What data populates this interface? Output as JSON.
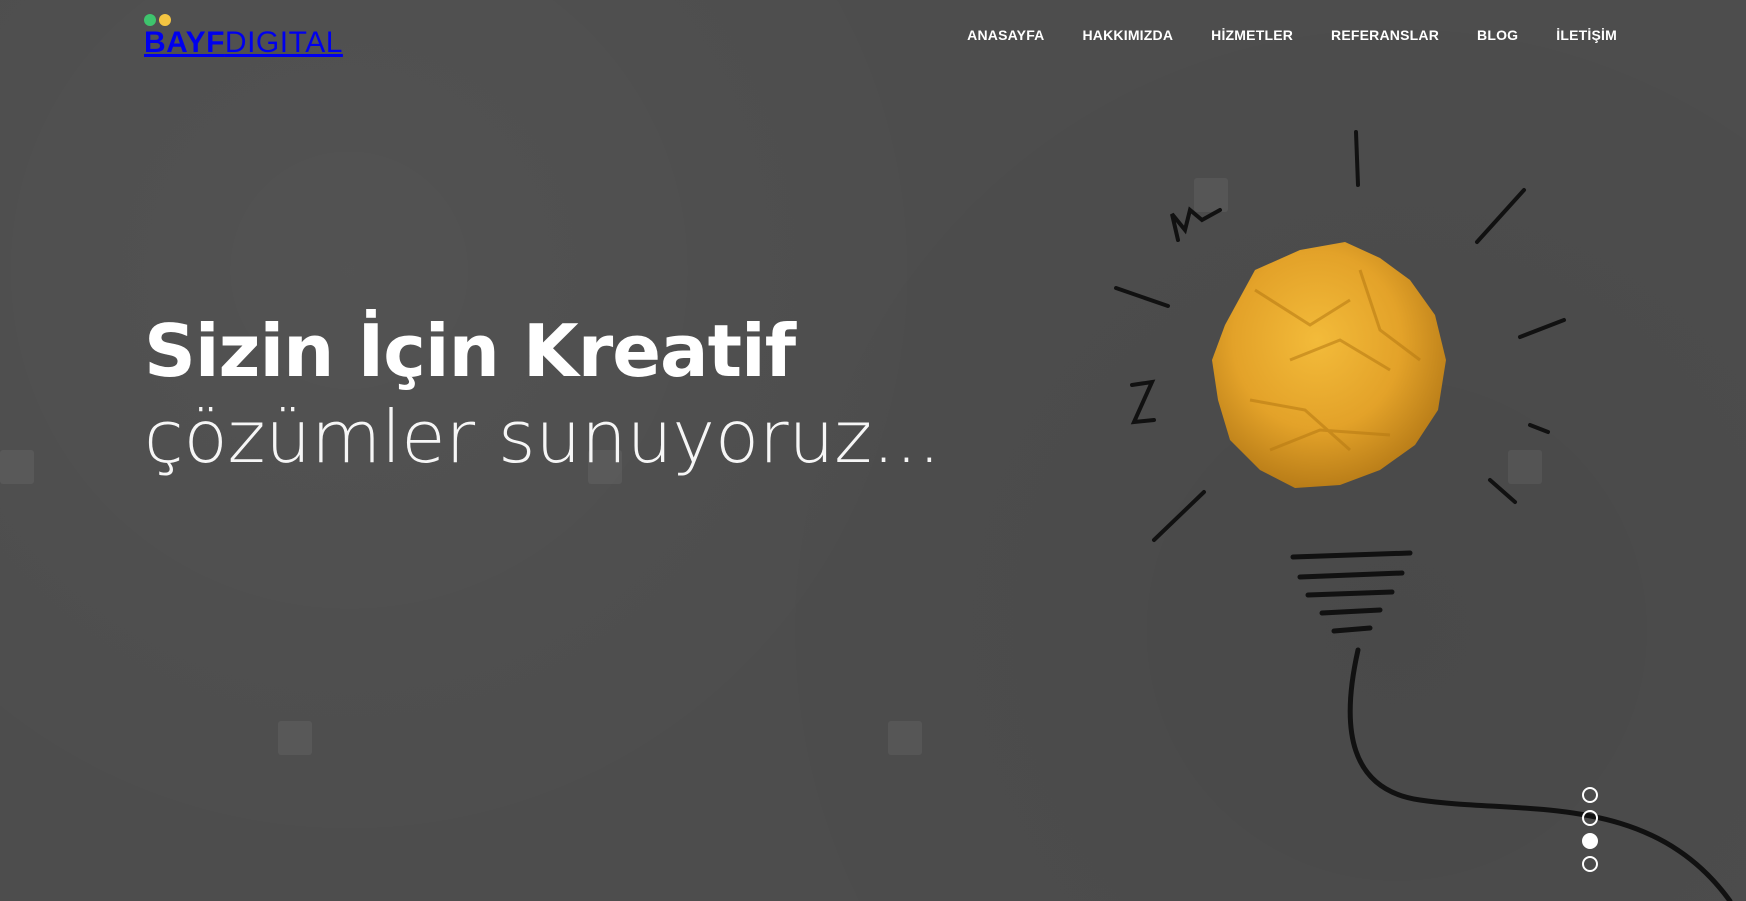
{
  "brand": {
    "name_bold": "BAYF",
    "name_light": "DIGITAL",
    "dot_colors": [
      "#3ec46d",
      "#f4c542"
    ]
  },
  "nav": {
    "items": [
      {
        "label": "ANASAYFA"
      },
      {
        "label": "HAKKIMIZDA"
      },
      {
        "label": "HİZMETLER"
      },
      {
        "label": "REFERANSLAR"
      },
      {
        "label": "BLOG"
      },
      {
        "label": "İLETİŞİM"
      }
    ]
  },
  "hero": {
    "title": "Sizin İçin Kreatif",
    "subtitle": "çözümler sunuyoruz..."
  },
  "slider": {
    "slide_count": 4,
    "active_index": 2
  },
  "colors": {
    "background": "#4d4d4d",
    "bulb": "#e8a92a",
    "text": "#ffffff"
  },
  "illustration": {
    "icon": "crumpled-paper-lightbulb-icon"
  }
}
